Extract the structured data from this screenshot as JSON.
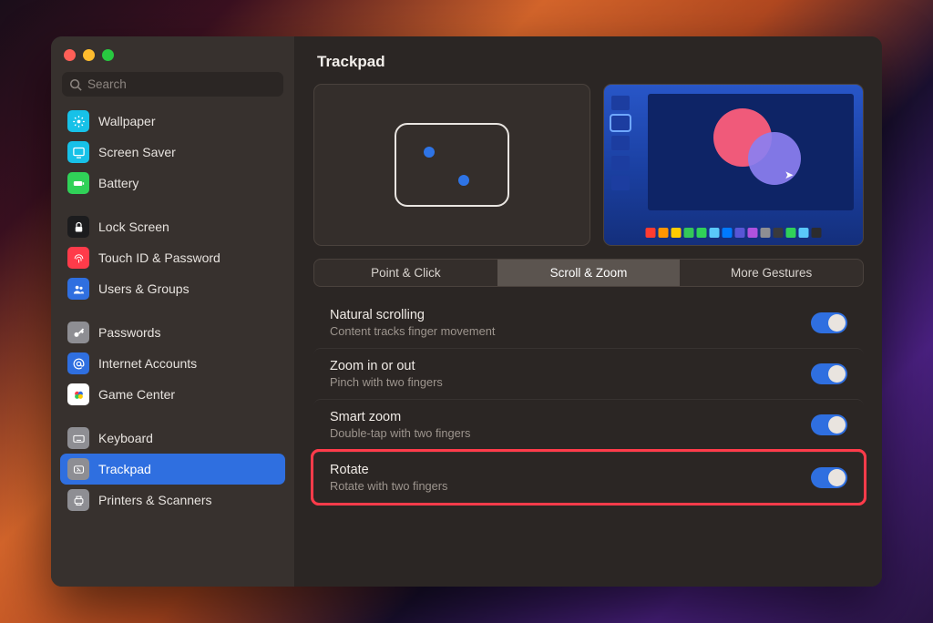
{
  "search": {
    "placeholder": "Search"
  },
  "sidebar": {
    "groups": [
      [
        {
          "label": "Wallpaper",
          "icon": "wallpaper",
          "bg": "#17c1e8"
        },
        {
          "label": "Screen Saver",
          "icon": "screensaver",
          "bg": "#17c1e8"
        },
        {
          "label": "Battery",
          "icon": "battery",
          "bg": "#30d158"
        }
      ],
      [
        {
          "label": "Lock Screen",
          "icon": "lock",
          "bg": "#1c1c1e"
        },
        {
          "label": "Touch ID & Password",
          "icon": "fingerprint",
          "bg": "#ff3b4a"
        },
        {
          "label": "Users & Groups",
          "icon": "users",
          "bg": "#2f6fe0"
        }
      ],
      [
        {
          "label": "Passwords",
          "icon": "key",
          "bg": "#8e8e93"
        },
        {
          "label": "Internet Accounts",
          "icon": "at",
          "bg": "#2f6fe0"
        },
        {
          "label": "Game Center",
          "icon": "game",
          "bg": "#ffffff"
        }
      ],
      [
        {
          "label": "Keyboard",
          "icon": "keyboard",
          "bg": "#8e8e93"
        },
        {
          "label": "Trackpad",
          "icon": "trackpad",
          "bg": "#8e8e93",
          "selected": true
        },
        {
          "label": "Printers & Scanners",
          "icon": "printer",
          "bg": "#8e8e93"
        }
      ]
    ]
  },
  "title": "Trackpad",
  "tabs": [
    {
      "label": "Point & Click"
    },
    {
      "label": "Scroll & Zoom",
      "active": true
    },
    {
      "label": "More Gestures"
    }
  ],
  "options": [
    {
      "title": "Natural scrolling",
      "subtitle": "Content tracks finger movement",
      "on": true
    },
    {
      "title": "Zoom in or out",
      "subtitle": "Pinch with two fingers",
      "on": true
    },
    {
      "title": "Smart zoom",
      "subtitle": "Double-tap with two fingers",
      "on": true
    },
    {
      "title": "Rotate",
      "subtitle": "Rotate with two fingers",
      "on": true,
      "highlight": true
    }
  ],
  "dock_colors": [
    "#ff3b30",
    "#ff9500",
    "#ffcc00",
    "#34c759",
    "#30d158",
    "#5ac8fa",
    "#007aff",
    "#5856d6",
    "#af52de",
    "#8e8e93",
    "#3a3a3c",
    "#30d158",
    "#5ac8fa",
    "#2c2c2e"
  ]
}
